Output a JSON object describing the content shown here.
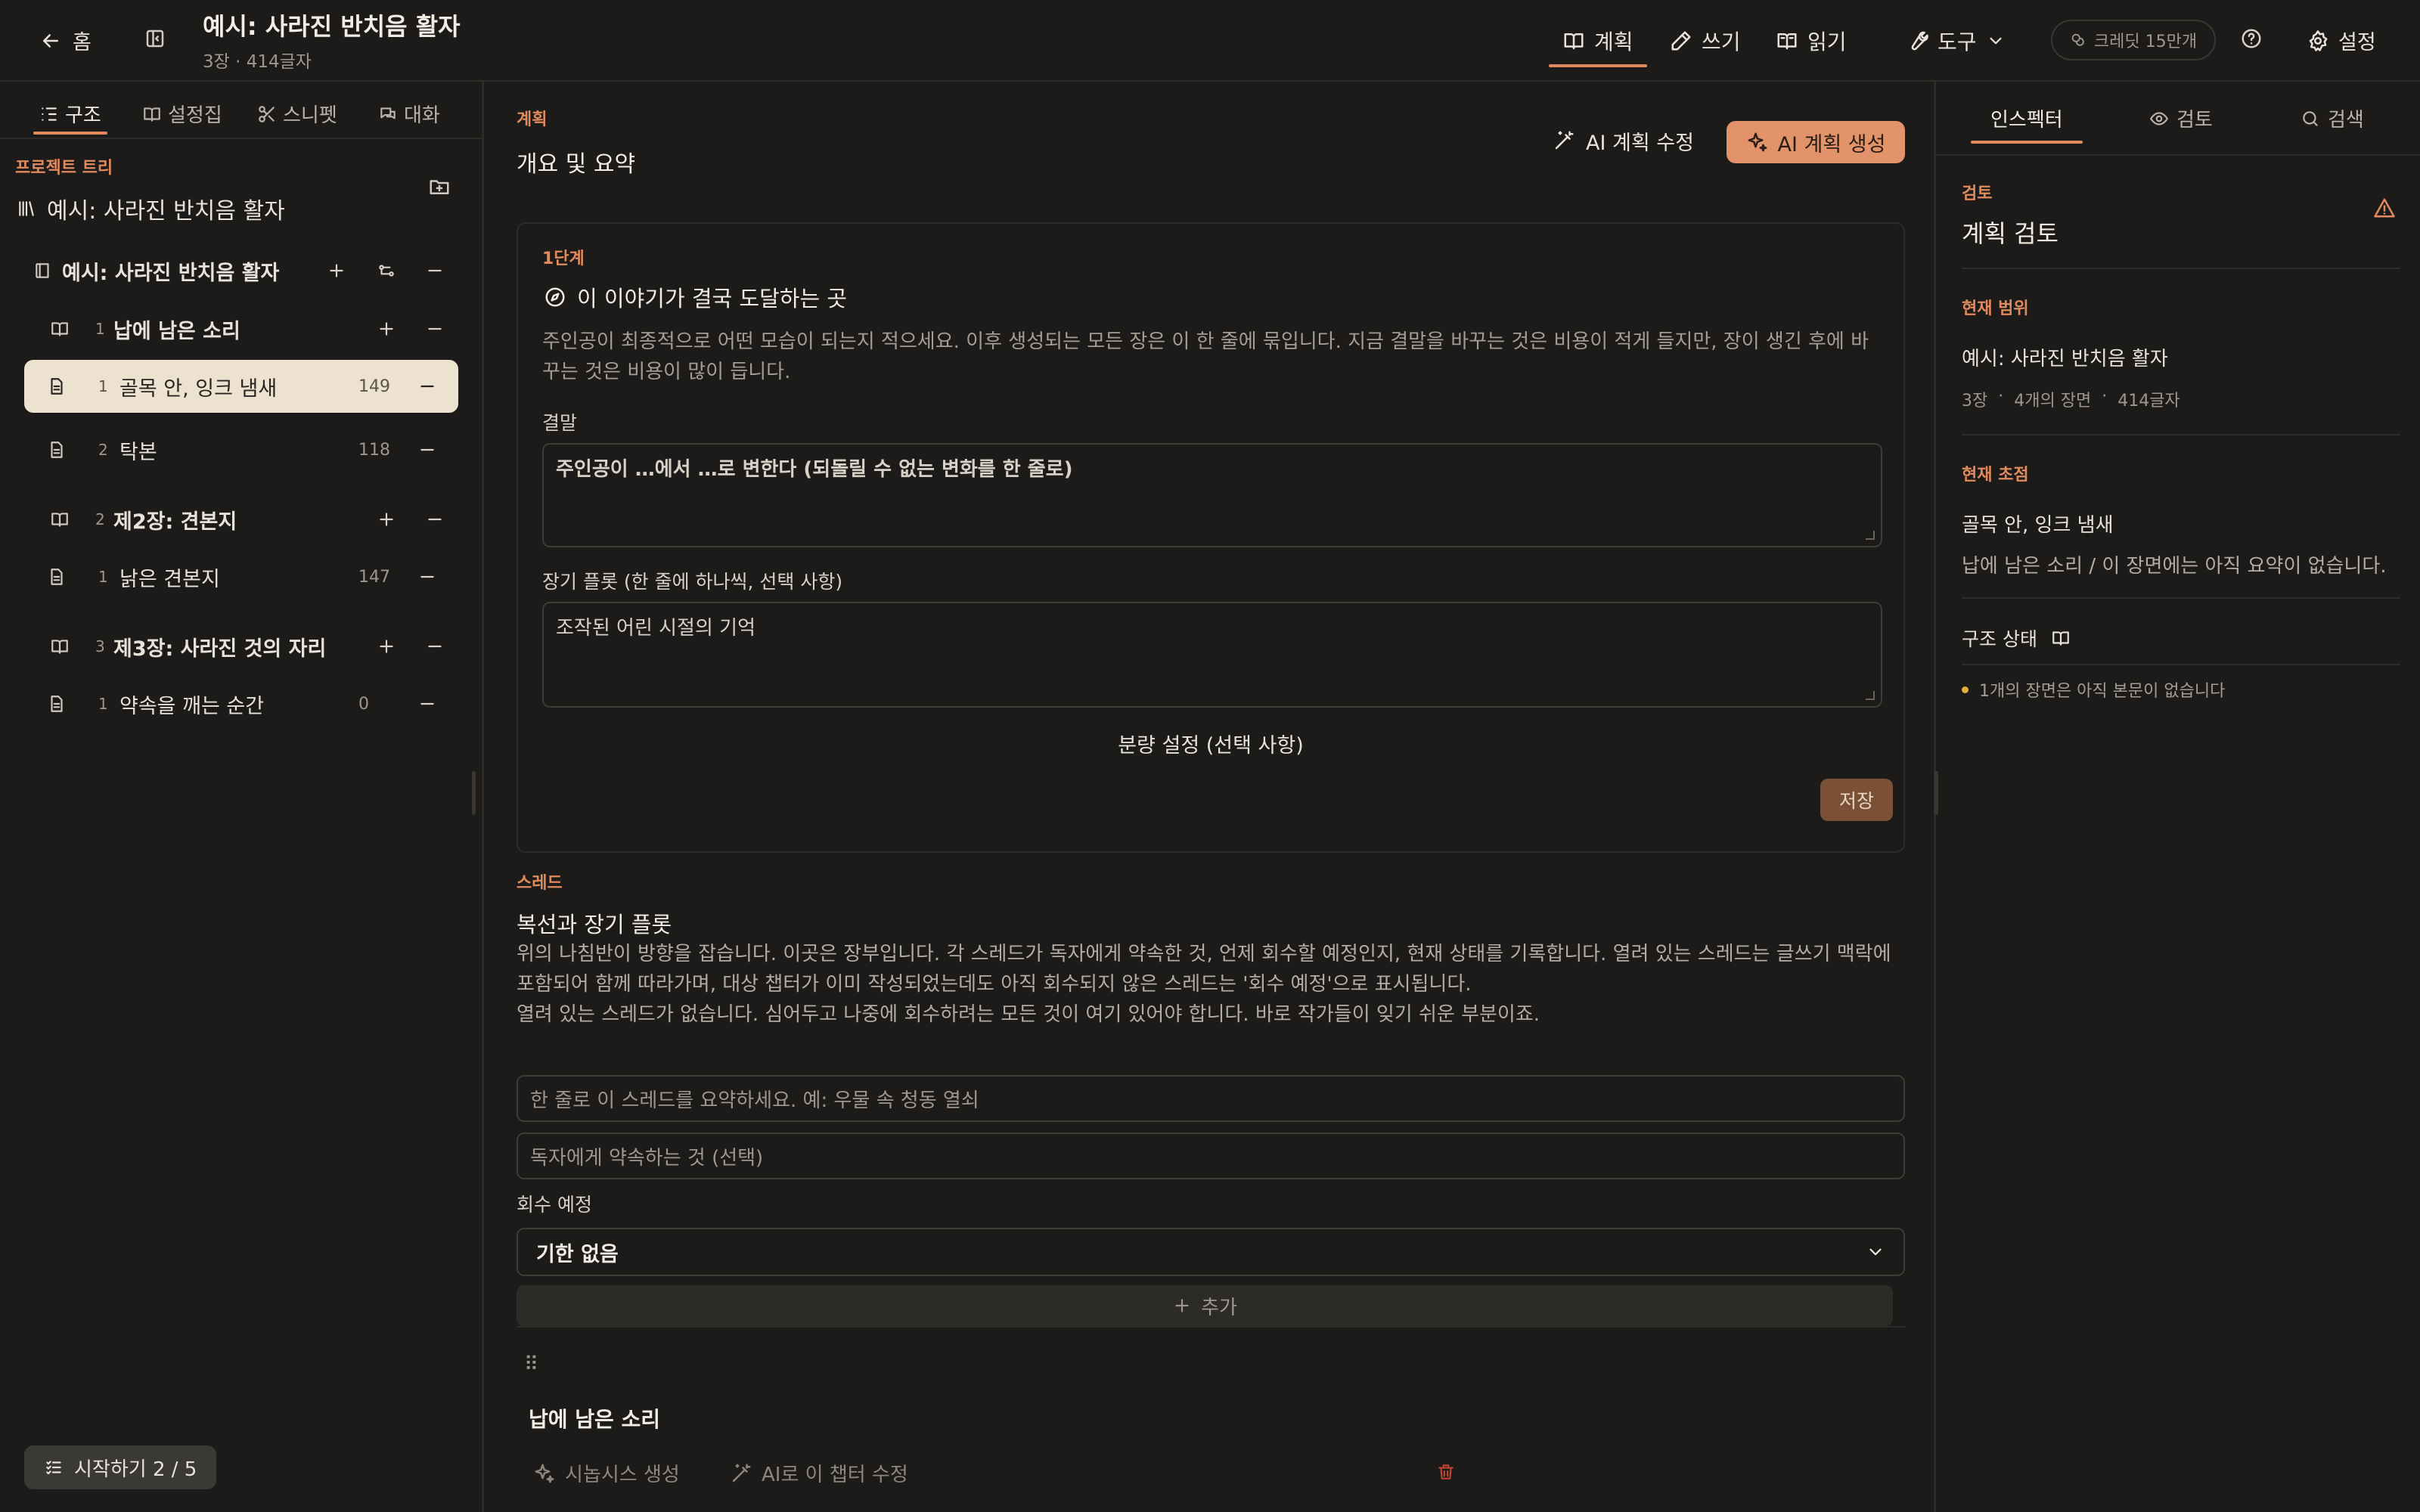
{
  "topbar": {
    "home_label": "홈",
    "title": "예시: 사라진 반치음 활자",
    "subtitle": "3장 · 414글자",
    "modes": [
      {
        "label": "계획",
        "icon": "book-open-icon",
        "active": true
      },
      {
        "label": "쓰기",
        "icon": "pencil-icon",
        "active": false
      },
      {
        "label": "읽기",
        "icon": "book-reader-icon",
        "active": false
      }
    ],
    "tools_label": "도구",
    "credit_label": "크레딧 15만개",
    "settings_label": "설정"
  },
  "left": {
    "tabs": [
      {
        "label": "구조",
        "icon": "list-tree-icon",
        "active": true
      },
      {
        "label": "설정집",
        "icon": "book-open-icon",
        "active": false
      },
      {
        "label": "스니펫",
        "icon": "scissors-icon",
        "active": false
      },
      {
        "label": "대화",
        "icon": "chat-icon",
        "active": false
      }
    ],
    "section_label": "프로젝트 트리",
    "project_name": "예시: 사라진 반치음 활자",
    "book_title": "예시: 사라진 반치음 활자",
    "chapters": [
      {
        "num": "1",
        "title": "납에 남은 소리",
        "scenes": [
          {
            "num": "1",
            "title": "골목 안, 잉크 냄새",
            "count": "149",
            "selected": true
          },
          {
            "num": "2",
            "title": "탁본",
            "count": "118",
            "selected": false
          }
        ]
      },
      {
        "num": "2",
        "title": "제2장: 견본지",
        "scenes": [
          {
            "num": "1",
            "title": "낡은 견본지",
            "count": "147",
            "selected": false
          }
        ]
      },
      {
        "num": "3",
        "title": "제3장: 사라진 것의 자리",
        "scenes": [
          {
            "num": "1",
            "title": "약속을 깨는 순간",
            "count": "0",
            "selected": false
          }
        ]
      }
    ],
    "getting_started": "시작하기 2 / 5"
  },
  "center": {
    "eyebrow": "계획",
    "heading": "개요 및 요약",
    "ai_edit_label": "AI 계획 수정",
    "ai_generate_label": "AI 계획 생성",
    "step": {
      "eyebrow": "1단계",
      "question": "이 이야기가 결국 도달하는 곳",
      "description": "주인공이 최종적으로 어떤 모습이 되는지 적으세요. 이후 생성되는 모든 장은 이 한 줄에 묶입니다. 지금 결말을 바꾸는 것은 비용이 적게 들지만, 장이 생긴 후에 바꾸는 것은 비용이 많이 듭니다.",
      "ending_label": "결말",
      "ending_value": "주인공이 …에서 …로 변한다 (되돌릴 수 없는 변화를 한 줄로)",
      "plot_label": "장기 플롯 (한 줄에 하나씩, 선택 사항)",
      "plot_value": "조작된 어린 시절의 기억",
      "volume_label": "분량 설정 (선택 사항)",
      "save_label": "저장"
    },
    "threads": {
      "eyebrow": "스레드",
      "heading": "복선과 장기 플롯",
      "description": "위의 나침반이 방향을 잡습니다. 이곳은 장부입니다. 각 스레드가 독자에게 약속한 것, 언제 회수할 예정인지, 현재 상태를 기록합니다. 열려 있는 스레드는 글쓰기 맥락에 포함되어 함께 따라가며, 대상 챕터가 이미 작성되었는데도 아직 회수되지 않은 스레드는 '회수 예정'으로 표시됩니다.",
      "empty_text": "열려 있는 스레드가 없습니다. 심어두고 나중에 회수하려는 모든 것이 여기 있어야 합니다. 바로 작가들이 잊기 쉬운 부분이죠.",
      "summary_placeholder": "한 줄로 이 스레드를 요약하세요. 예: 우물 속 청동 열쇠",
      "promise_placeholder": "독자에게 약속하는 것 (선택)",
      "payoff_label": "회수 예정",
      "payoff_value": "기한 없음",
      "add_label": "추가"
    },
    "chapter": {
      "title": "납에 남은 소리",
      "synopsis_label": "시놉시스 생성",
      "ai_edit_label": "AI로 이 챕터 수정"
    }
  },
  "right": {
    "tabs": [
      {
        "label": "인스펙터",
        "active": true
      },
      {
        "label": "검토",
        "icon": "eye-icon",
        "active": false
      },
      {
        "label": "검색",
        "icon": "search-icon",
        "active": false
      }
    ],
    "review_eyebrow": "검토",
    "review_title": "계획 검토",
    "scope_eyebrow": "현재 범위",
    "scope_title": "예시: 사라진 반치음 활자",
    "scope_meta": [
      "3장",
      "·",
      "4개의 장면",
      "·",
      "414글자"
    ],
    "focus_eyebrow": "현재 초점",
    "focus_title": "골목 안, 잉크 냄새",
    "focus_desc": "납에 남은 소리 / 이 장면에는 아직 요약이 없습니다.",
    "structure_label": "구조 상태",
    "structure_items": [
      "1개의 장면은 아직 본문이 없습니다"
    ]
  },
  "colors": {
    "background": "#1c1b19",
    "accent": "#e08a5d",
    "primary_button": "#e3936a",
    "selected_row": "#ede2cf",
    "warning_dot": "#e0b13e",
    "danger": "#c0462f"
  }
}
